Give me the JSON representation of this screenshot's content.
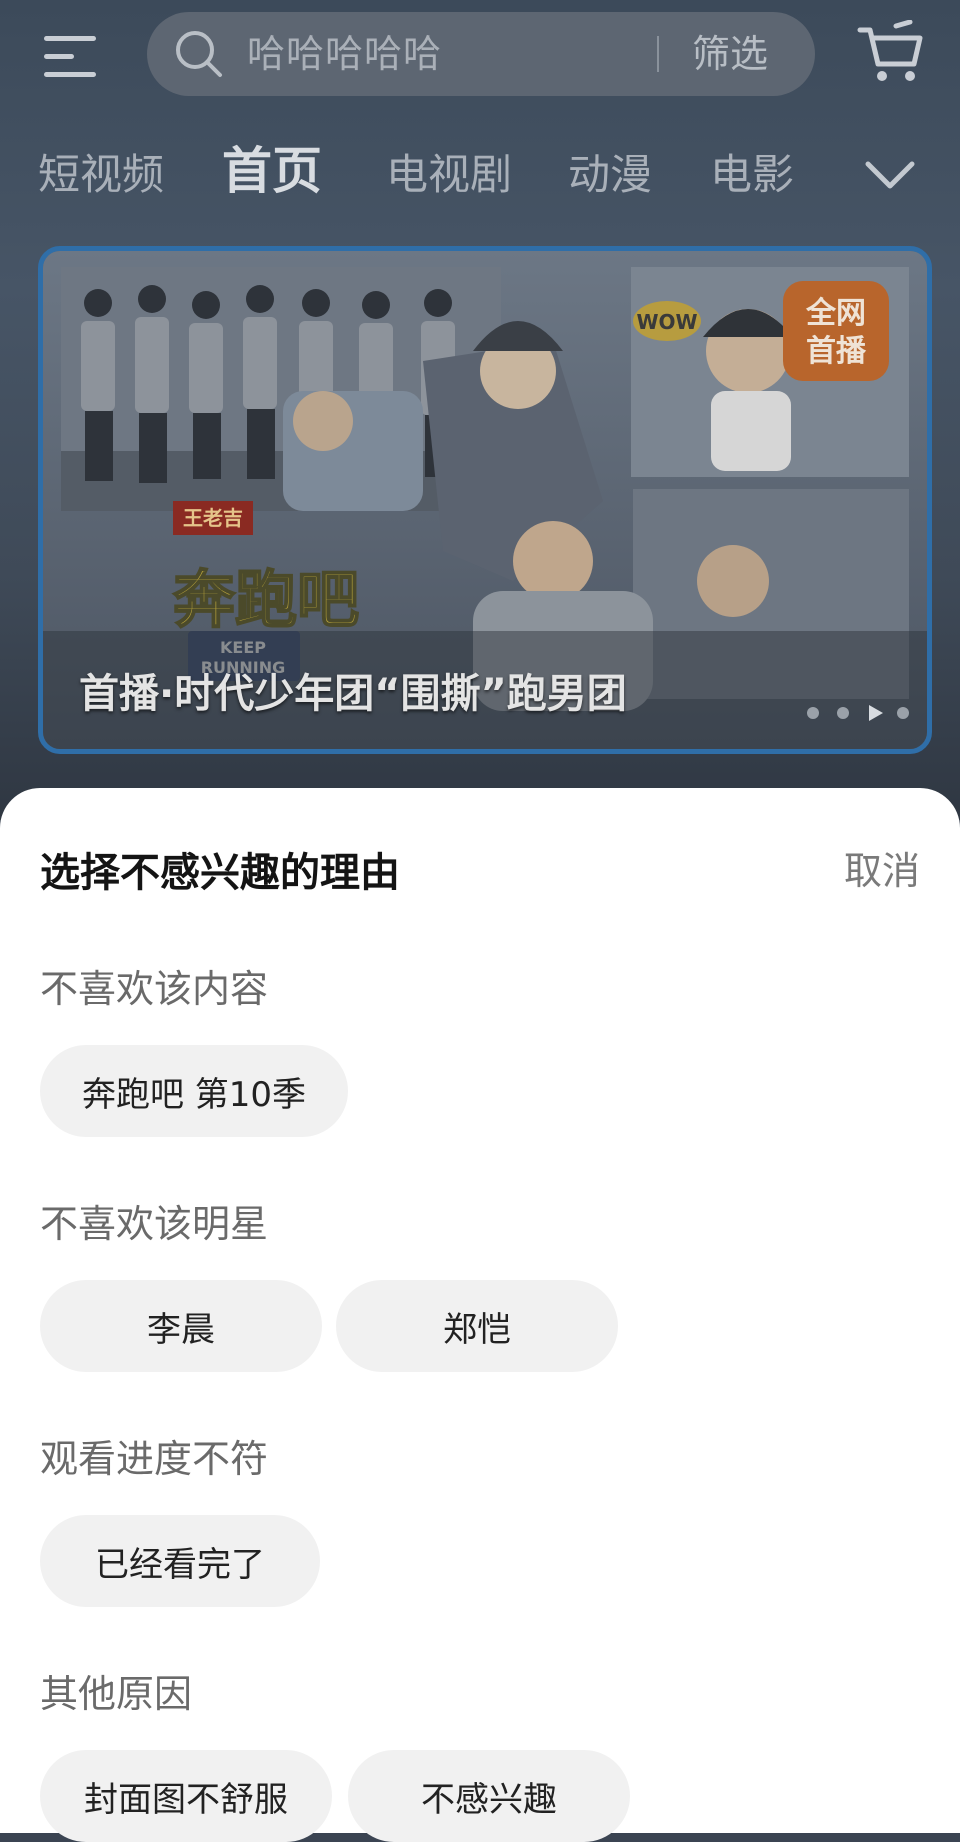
{
  "search": {
    "placeholder": "哈哈哈哈哈",
    "filter_label": "筛选"
  },
  "nav_tabs": [
    {
      "label": "短视频"
    },
    {
      "label": "首页",
      "active": true
    },
    {
      "label": "电视剧"
    },
    {
      "label": "动漫"
    },
    {
      "label": "电影"
    }
  ],
  "banner": {
    "title": "首播·时代少年团“围撕”跑男团",
    "logo_text": "奔跑吧",
    "logo_subtitle": "KEEP RUNNING",
    "logo_sponsor": "王老吉",
    "badge": "全网首播",
    "sticker": "WOW",
    "dot_count": 4,
    "active_dot": 3
  },
  "sheet": {
    "title": "选择不感兴趣的理由",
    "cancel_label": "取消",
    "sections": [
      {
        "label": "不喜欢该内容",
        "options": [
          "奔跑吧 第10季"
        ]
      },
      {
        "label": "不喜欢该明星",
        "options": [
          "李晨",
          "郑恺"
        ]
      },
      {
        "label": "观看进度不符",
        "options": [
          "已经看完了"
        ]
      },
      {
        "label": "其他原因",
        "options": [
          "封面图不舒服",
          "不感兴趣"
        ]
      }
    ]
  },
  "colors": {
    "overlay_bg": "#3b4452",
    "sheet_bg": "#ffffff",
    "chip_bg": "#f1f1f1",
    "banner_border": "#2f6ea8"
  }
}
